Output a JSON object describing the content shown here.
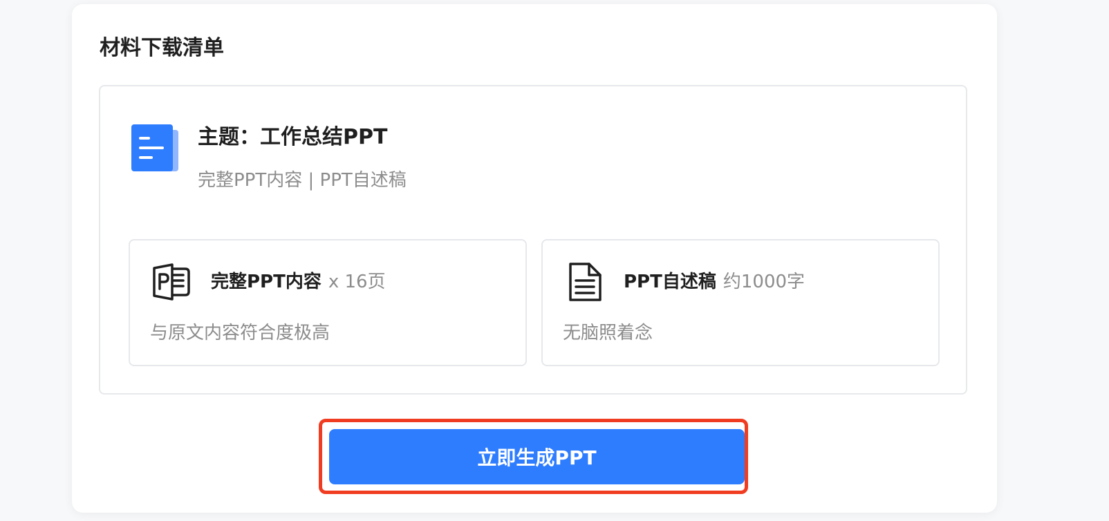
{
  "card": {
    "title": "材料下载清单"
  },
  "topic": {
    "icon": "document-icon",
    "title": "主题：工作总结PPT",
    "description": "完整PPT内容 | PPT自述稿"
  },
  "items": [
    {
      "icon": "ppt-file-icon",
      "name": "完整PPT内容",
      "quantity": "x 16页",
      "description": "与原文内容符合度极高"
    },
    {
      "icon": "text-document-icon",
      "name": "PPT自述稿",
      "quantity": "约1000字",
      "description": "无脑照着念"
    }
  ],
  "action": {
    "generate_label": "立即生成PPT"
  },
  "colors": {
    "accent": "#2e7dff",
    "accent_light": "#8fb6ff",
    "highlight": "#f03c21",
    "text_primary": "#1f1f1f",
    "text_secondary": "#8c8c8c",
    "border": "#e6e8eb"
  }
}
